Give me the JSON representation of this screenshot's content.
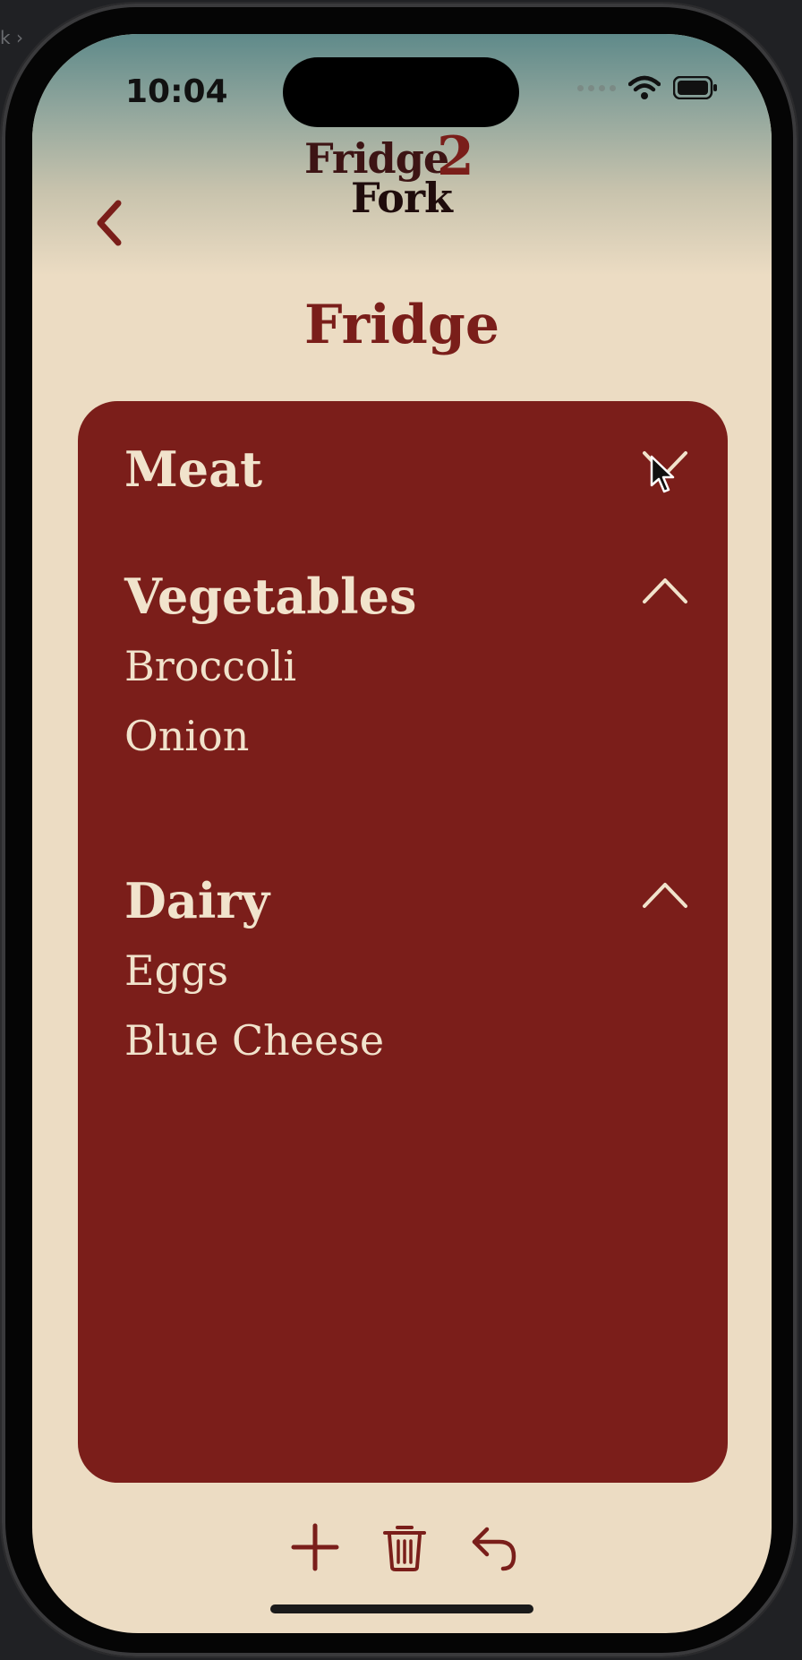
{
  "status": {
    "time": "10:04"
  },
  "header": {
    "logo_line1": "Fridge",
    "logo_digit": "2",
    "logo_line2": "Fork",
    "back_icon": "chevron-left-icon"
  },
  "page": {
    "title": "Fridge"
  },
  "sections": [
    {
      "title": "Meat",
      "expanded": false,
      "items": []
    },
    {
      "title": "Vegetables",
      "expanded": true,
      "items": [
        "Broccoli",
        "Onion"
      ]
    },
    {
      "title": "Dairy",
      "expanded": true,
      "items": [
        "Eggs",
        "Blue Cheese"
      ]
    }
  ],
  "toolbar": {
    "add_icon": "plus-icon",
    "delete_icon": "trash-icon",
    "undo_icon": "undo-icon"
  },
  "colors": {
    "background": "#ecdcc3",
    "card": "#7b1e1a",
    "accent": "#7a1e1a",
    "card_text": "#f1e3cc"
  }
}
